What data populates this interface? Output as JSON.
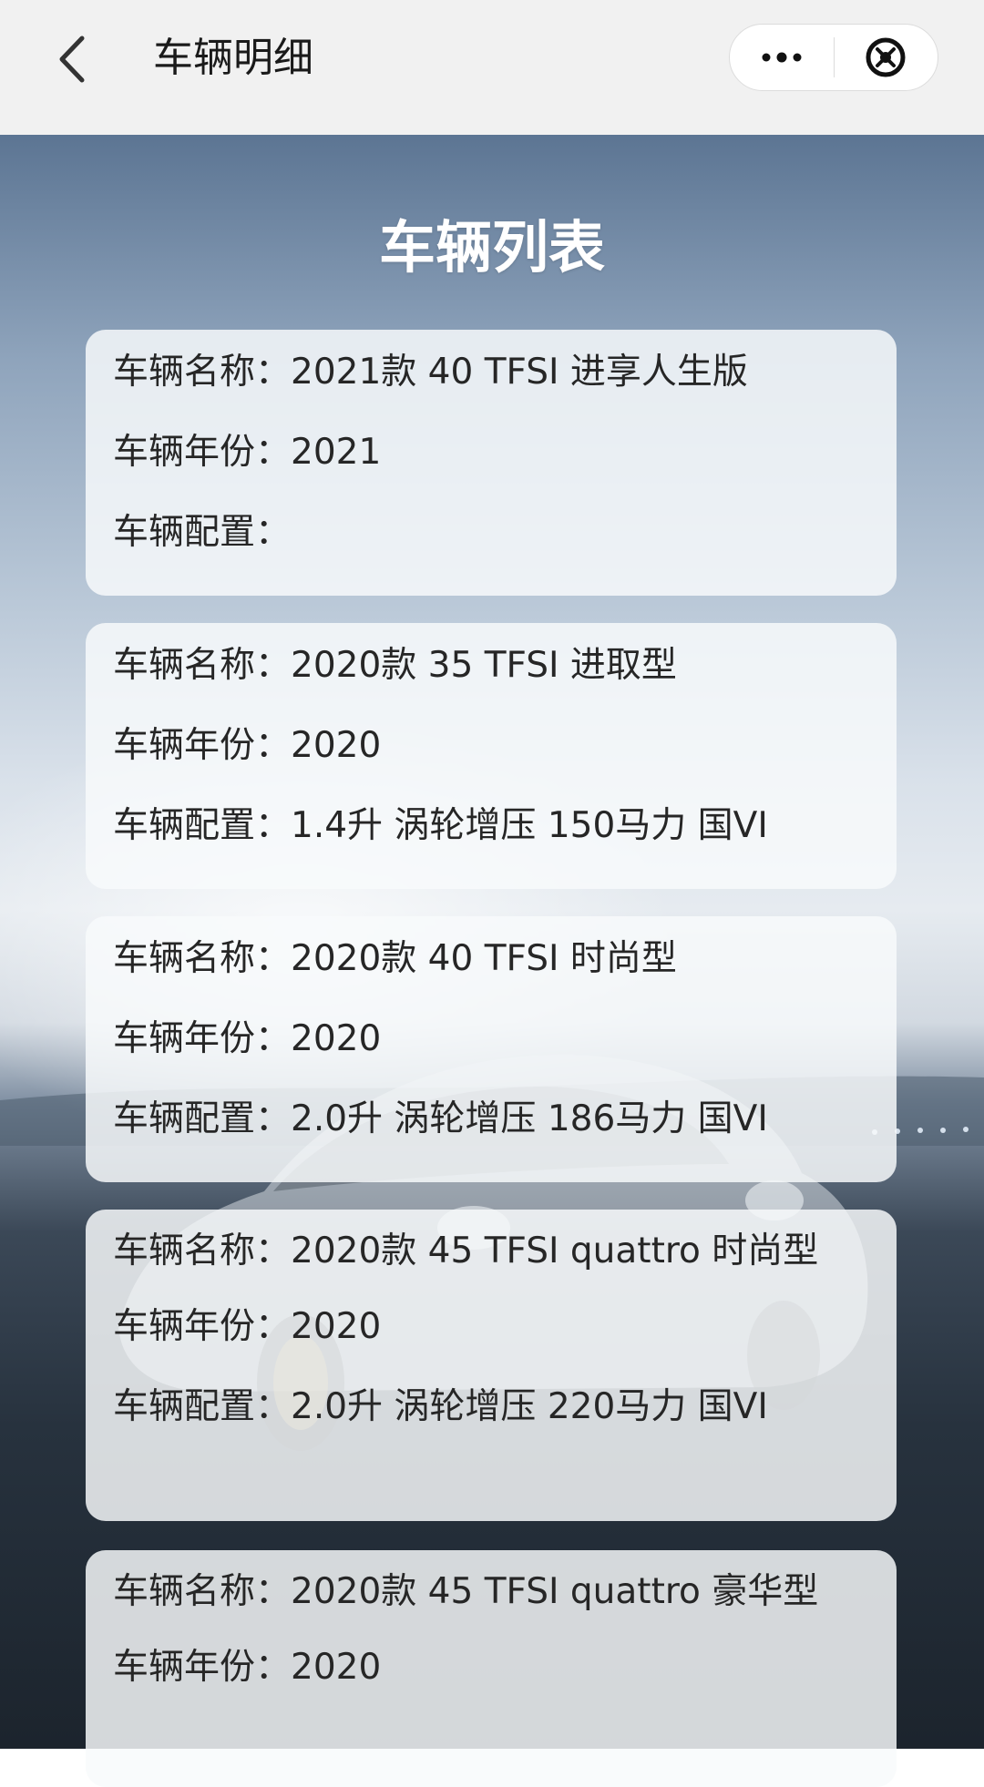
{
  "navbar": {
    "title": "车辆明细",
    "back_icon": "chevron-left-icon",
    "more_icon": "more-dots-icon",
    "close_icon": "close-circle-icon"
  },
  "page": {
    "list_title": "车辆列表"
  },
  "labels": {
    "name": "车辆名称：",
    "year": "车辆年份：",
    "config": "车辆配置："
  },
  "vehicles": [
    {
      "name": "2021款 40 TFSI 进享人生版",
      "year": "2021",
      "config": ""
    },
    {
      "name": "2020款 35 TFSI 进取型",
      "year": "2020",
      "config": "1.4升 涡轮增压 150马力 国VI"
    },
    {
      "name": "2020款 40 TFSI 时尚型",
      "year": "2020",
      "config": "2.0升 涡轮增压 186马力 国VI"
    },
    {
      "name": "2020款 45 TFSI quattro 时尚型",
      "year": "2020",
      "config": "2.0升 涡轮增压 220马力 国VI"
    },
    {
      "name": "2020款 45 TFSI quattro 豪华型",
      "year": "2020",
      "config": ""
    }
  ],
  "colors": {
    "navbar_bg": "#f1f1f1",
    "card_bg": "#f8fafc",
    "title_text": "#ffffff",
    "body_text": "#262626"
  }
}
